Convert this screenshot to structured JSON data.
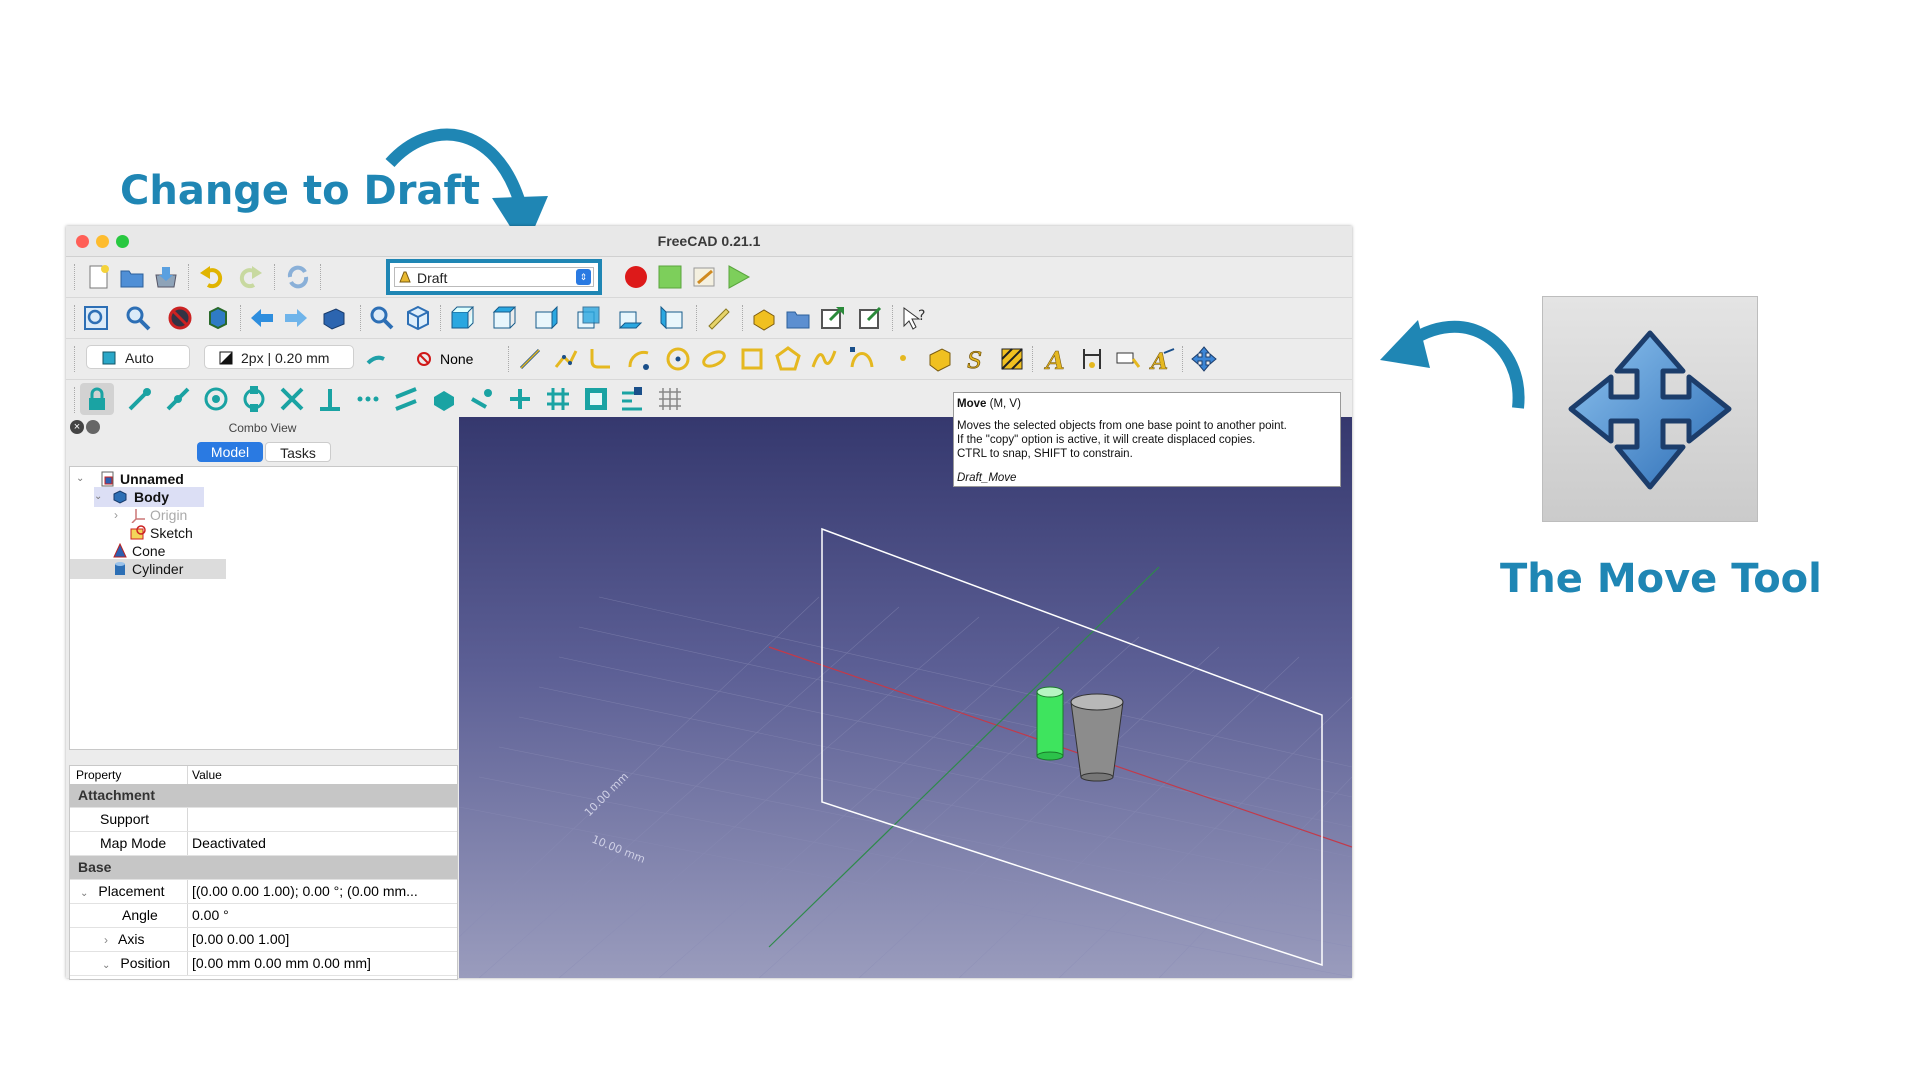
{
  "annotations": {
    "change_to_draft": "Change to Draft",
    "move_tool_title": "The Move Tool",
    "arrow_color": "#1f86b4",
    "move_big_icon": "move-arrows-icon"
  },
  "window": {
    "title": "FreeCAD 0.21.1",
    "traffic_lights": [
      "#ff5f57",
      "#febc2e",
      "#28c840"
    ]
  },
  "toolbar": {
    "workbench": "Draft",
    "construction_mode": "Auto",
    "line_width": "2px | 0.20 mm",
    "snap_mode": "None"
  },
  "tooltip": {
    "title": "Move",
    "shortcut": "(M, V)",
    "line1": "Moves the selected objects from one base point to another point.",
    "line2": "If the \"copy\" option is active, it will create displaced copies.",
    "line3": "CTRL to snap, SHIFT to constrain.",
    "command": "Draft_Move"
  },
  "combo": {
    "label": "Combo View",
    "tabs": [
      {
        "label": "Model",
        "active": true
      },
      {
        "label": "Tasks",
        "active": false
      }
    ]
  },
  "tree": {
    "items": [
      {
        "label": "Unnamed"
      },
      {
        "label": "Body"
      },
      {
        "label": "Origin"
      },
      {
        "label": "Sketch"
      },
      {
        "label": "Cone"
      },
      {
        "label": "Cylinder"
      }
    ]
  },
  "properties": {
    "header_property": "Property",
    "header_value": "Value",
    "rows": [
      {
        "name": "Attachment",
        "value": ""
      },
      {
        "name": "Support",
        "value": ""
      },
      {
        "name": "Map Mode",
        "value": "Deactivated"
      },
      {
        "name": "Base",
        "value": ""
      },
      {
        "name": "Placement",
        "value": "[(0.00 0.00 1.00); 0.00 °; (0.00 mm..."
      },
      {
        "name": "Angle",
        "value": "0.00 °"
      },
      {
        "name": "Axis",
        "value": "[0.00 0.00 1.00]"
      },
      {
        "name": "Position",
        "value": "[0.00 mm  0.00 mm  0.00 mm]"
      }
    ]
  },
  "viewport": {
    "grid_label_1": "10.00 mm",
    "grid_label_2": "10.00 mm",
    "cylinder_color": "#4cde6a",
    "cone_color": "#9a9a9a"
  }
}
